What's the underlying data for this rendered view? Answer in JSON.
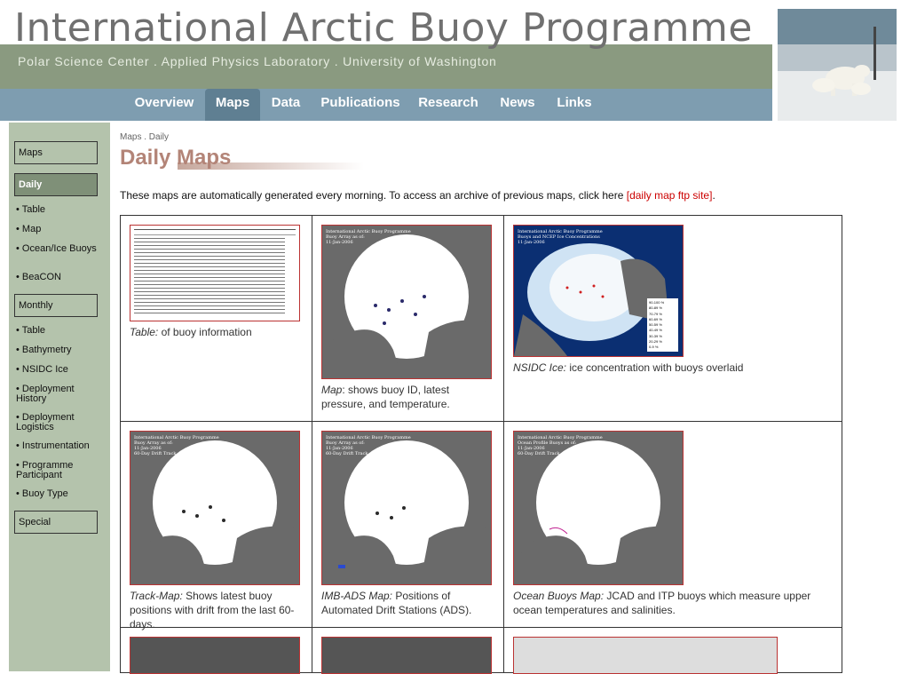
{
  "header": {
    "title": "International Arctic Buoy Programme",
    "subtitle": "Polar Science Center . Applied Physics Laboratory . University of Washington"
  },
  "nav": [
    {
      "label": "Overview"
    },
    {
      "label": "Maps"
    },
    {
      "label": "Data"
    },
    {
      "label": "Publications"
    },
    {
      "label": "Research"
    },
    {
      "label": "News"
    },
    {
      "label": "Links"
    }
  ],
  "sidebar": {
    "maps": "Maps",
    "daily": "Daily",
    "daily_links": [
      "Table",
      "Map",
      "Ocean/Ice Buoys",
      "BeaCON"
    ],
    "monthly": "Monthly",
    "monthly_links": [
      "Table",
      "Bathymetry",
      "NSIDC Ice",
      "Deployment History",
      "Deployment Logistics",
      "Instrumentation",
      "Programme Participant",
      "Buoy Type"
    ],
    "special": "Special"
  },
  "breadcrumb": "Maps . Daily",
  "page_title": "Daily Maps",
  "intro": {
    "text": "These maps are automatically generated every morning. To access an archive of previous maps, click here ",
    "link": "[daily map ftp site]",
    "end": "."
  },
  "cells": [
    {
      "label": "Table:",
      "text": " of buoy information"
    },
    {
      "label": "Map",
      "text": ": shows buoy ID, latest pressure, and temperature."
    },
    {
      "label": "NSIDC Ice:",
      "text": " ice concentration with buoys overlaid"
    },
    {
      "label": "Track-Map:",
      "text": " Shows latest buoy positions with drift from the last 60-days."
    },
    {
      "label": "IMB-ADS Map:",
      "text": " Positions of Automated Drift Stations (ADS)."
    },
    {
      "label": "Ocean Buoys Map:",
      "text": " JCAD and ITP buoys which measure upper ocean temperatures and salinities."
    }
  ],
  "thumb_titles": {
    "map": "International Arctic Buoy Programme\nBuoy Array as of:\n11-Jan-2006",
    "nsidc": "International Arctic Buoy Programme\nBuoys and NCEP Ice Concentrations\n11-Jan-2006",
    "track": "International Arctic Buoy Programme\nBuoy Array as of:\n11-Jan-2006\n60-Day Drift Track",
    "ocean": "International Arctic Buoy Programme\nOcean Profile Buoys as of:\n11-Jan-2006\n60-Day Drift Track"
  },
  "nsidc_legend": [
    "90-100 %",
    "80-89 %",
    "70-79 %",
    "60-69 %",
    "50-59 %",
    "40-49 %",
    "30-39 %",
    "20-29 %",
    "0-9 %"
  ]
}
